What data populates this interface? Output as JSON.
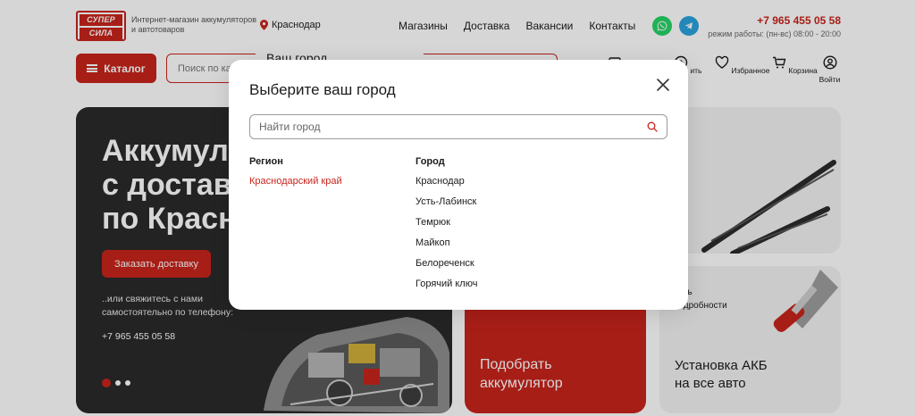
{
  "header": {
    "logo_line1": "СУПЕР",
    "logo_line2": "СИЛА",
    "tagline": "Интернет-магазин аккумуляторов и автотоваров",
    "city": "Краснодар",
    "nav": [
      "Магазины",
      "Доставка",
      "Вакансии",
      "Контакты"
    ],
    "phone": "+7 965 455 05 58",
    "hours": "режим работы: (пн-вс) 08:00 - 20:00"
  },
  "toolbar": {
    "catalog_label": "Каталог",
    "search_placeholder": "Поиск по ка",
    "icons": [
      {
        "label": "",
        "icon": "calendar-icon"
      },
      {
        "label": "ить",
        "icon": "compare-icon"
      },
      {
        "label": "Избранное",
        "icon": "heart-icon"
      },
      {
        "label": "Корзина",
        "icon": "cart-icon"
      },
      {
        "label": "Войти",
        "icon": "user-icon"
      }
    ]
  },
  "hero": {
    "title": "Аккумул\nс достав\nпо Красн",
    "order_button": "Заказать доставку",
    "note": "..или свяжитесь с нами самостоятельно по телефону:",
    "phone": "+7 965 455 05 58"
  },
  "cards": {
    "battery": "Подобрать\nаккумулятор",
    "install_note": "нать\nподробности",
    "install_title": "Установка АКБ\nна все авто"
  },
  "tooltip_peek": "Ваш город",
  "modal": {
    "title": "Выберите ваш город",
    "search_placeholder": "Найти город",
    "region_header": "Регион",
    "city_header": "Город",
    "regions": [
      "Краснодарский край"
    ],
    "cities": [
      "Краснодар",
      "Усть-Лабинск",
      "Темрюк",
      "Майкоп",
      "Белореченск",
      "Горячий ключ"
    ]
  },
  "colors": {
    "accent": "#c8241c",
    "dark": "#2a2a2a"
  }
}
